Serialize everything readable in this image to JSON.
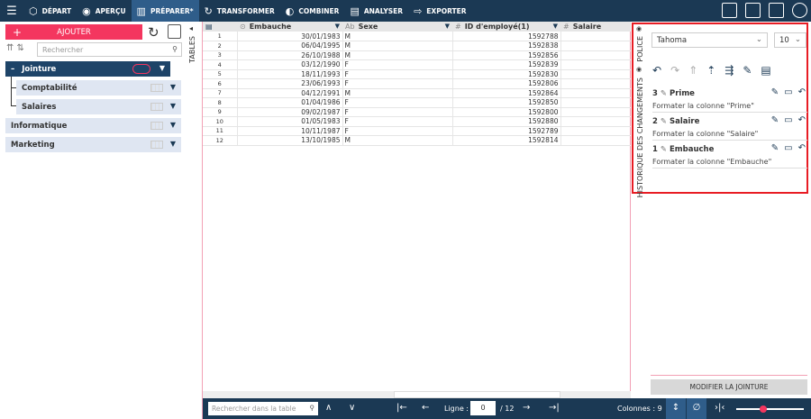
{
  "topbar": {
    "items": [
      {
        "label": "DÉPART",
        "icon": "cube-icon",
        "glyph": "⬡"
      },
      {
        "label": "APERÇU",
        "icon": "eye-icon",
        "glyph": "◉"
      },
      {
        "label": "PRÉPARER*",
        "icon": "prepare-icon",
        "glyph": "▥",
        "active": true
      },
      {
        "label": "TRANSFORMER",
        "icon": "transform-icon",
        "glyph": "↻"
      },
      {
        "label": "COMBINER",
        "icon": "combine-icon",
        "glyph": "◐"
      },
      {
        "label": "ANALYSER",
        "icon": "clipboard-icon",
        "glyph": "▤"
      },
      {
        "label": "EXPORTER",
        "icon": "export-icon",
        "glyph": "⇨"
      }
    ]
  },
  "left": {
    "add_label": "AJOUTER",
    "search_placeholder": "Rechercher",
    "join": "Jointure",
    "children": [
      "Comptabilité",
      "Salaires"
    ],
    "tables": [
      "Informatique",
      "Marketing"
    ]
  },
  "tables_label": "TABLES",
  "grid": {
    "columns": [
      {
        "name": "Embauche",
        "type": "⊙"
      },
      {
        "name": "Sexe",
        "type": "Ab"
      },
      {
        "name": "ID d'employé(1)",
        "type": "#"
      },
      {
        "name": "Salaire",
        "type": "#"
      }
    ],
    "rows": [
      [
        "1",
        "30/01/1983",
        "M",
        "1592788"
      ],
      [
        "2",
        "06/04/1995",
        "M",
        "1592838"
      ],
      [
        "3",
        "26/10/1988",
        "M",
        "1592856"
      ],
      [
        "4",
        "03/12/1990",
        "F",
        "1592839"
      ],
      [
        "5",
        "18/11/1993",
        "F",
        "1592830"
      ],
      [
        "6",
        "23/06/1993",
        "F",
        "1592806"
      ],
      [
        "7",
        "04/12/1991",
        "M",
        "1592864"
      ],
      [
        "8",
        "01/04/1986",
        "F",
        "1592850"
      ],
      [
        "9",
        "09/02/1987",
        "F",
        "1592800"
      ],
      [
        "10",
        "01/05/1983",
        "F",
        "1592880"
      ],
      [
        "11",
        "10/11/1987",
        "F",
        "1592789"
      ],
      [
        "12",
        "13/10/1985",
        "M",
        "1592814"
      ]
    ]
  },
  "right": {
    "police_label": "POLICE",
    "history_label": "HISTORIQUE DES CHANGEMENTS",
    "font": "Tahoma",
    "size": "10",
    "history": [
      {
        "num": "3",
        "name": "Prime",
        "desc": "Formater la colonne \"Prime\""
      },
      {
        "num": "2",
        "name": "Salaire",
        "desc": "Formater la colonne \"Salaire\""
      },
      {
        "num": "1",
        "name": "Embauche",
        "desc": "Formater la colonne \"Embauche\""
      }
    ],
    "modify_label": "MODIFIER LA JOINTURE"
  },
  "bottom": {
    "search_placeholder": "Rechercher dans la table",
    "ligne_label": "Ligne :",
    "ligne_value": "0",
    "ligne_total": "/ 12",
    "colonnes": "Colonnes : 9",
    "zoom_fraction": 0.4
  },
  "colors": {
    "accent": "#f4365f",
    "navy": "#1b3954",
    "highlight": "#e81c24"
  }
}
